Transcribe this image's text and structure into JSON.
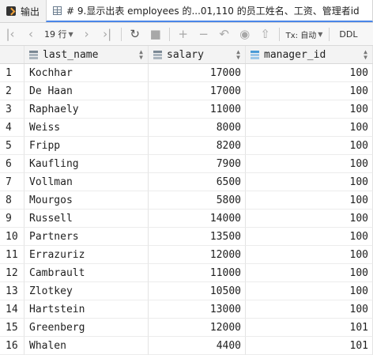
{
  "tabs": [
    {
      "label": "输出",
      "icon": "output-icon",
      "active": false
    },
    {
      "label": "# 9.显示出表 employees 的...01,110 的员工姓名、工资、管理者id",
      "icon": "table-grid-icon",
      "active": true
    }
  ],
  "toolbar": {
    "rows_label": "19 行",
    "tx_label": "Tx: 自动",
    "ddl_label": "DDL",
    "icons": [
      "first-page-icon",
      "prev-page-icon",
      "next-page-icon",
      "last-page-icon",
      "refresh-icon",
      "stop-icon",
      "add-row-icon",
      "delete-row-icon",
      "revert-icon",
      "preview-pending-icon",
      "submit-icon"
    ]
  },
  "table": {
    "columns": [
      {
        "label": "last_name",
        "icon": "column-icon"
      },
      {
        "label": "salary",
        "icon": "column-icon"
      },
      {
        "label": "manager_id",
        "icon": "foreign-key-column-icon"
      }
    ],
    "rows": [
      {
        "n": "1",
        "last_name": "Kochhar",
        "salary": "17000",
        "manager_id": "100"
      },
      {
        "n": "2",
        "last_name": "De Haan",
        "salary": "17000",
        "manager_id": "100"
      },
      {
        "n": "3",
        "last_name": "Raphaely",
        "salary": "11000",
        "manager_id": "100"
      },
      {
        "n": "4",
        "last_name": "Weiss",
        "salary": "8000",
        "manager_id": "100"
      },
      {
        "n": "5",
        "last_name": "Fripp",
        "salary": "8200",
        "manager_id": "100"
      },
      {
        "n": "6",
        "last_name": "Kaufling",
        "salary": "7900",
        "manager_id": "100"
      },
      {
        "n": "7",
        "last_name": "Vollman",
        "salary": "6500",
        "manager_id": "100"
      },
      {
        "n": "8",
        "last_name": "Mourgos",
        "salary": "5800",
        "manager_id": "100"
      },
      {
        "n": "9",
        "last_name": "Russell",
        "salary": "14000",
        "manager_id": "100"
      },
      {
        "n": "10",
        "last_name": "Partners",
        "salary": "13500",
        "manager_id": "100"
      },
      {
        "n": "11",
        "last_name": "Errazuriz",
        "salary": "12000",
        "manager_id": "100"
      },
      {
        "n": "12",
        "last_name": "Cambrault",
        "salary": "11000",
        "manager_id": "100"
      },
      {
        "n": "13",
        "last_name": "Zlotkey",
        "salary": "10500",
        "manager_id": "100"
      },
      {
        "n": "14",
        "last_name": "Hartstein",
        "salary": "13000",
        "manager_id": "100"
      },
      {
        "n": "15",
        "last_name": "Greenberg",
        "salary": "12000",
        "manager_id": "101"
      },
      {
        "n": "16",
        "last_name": "Whalen",
        "salary": "4400",
        "manager_id": "101"
      }
    ]
  }
}
